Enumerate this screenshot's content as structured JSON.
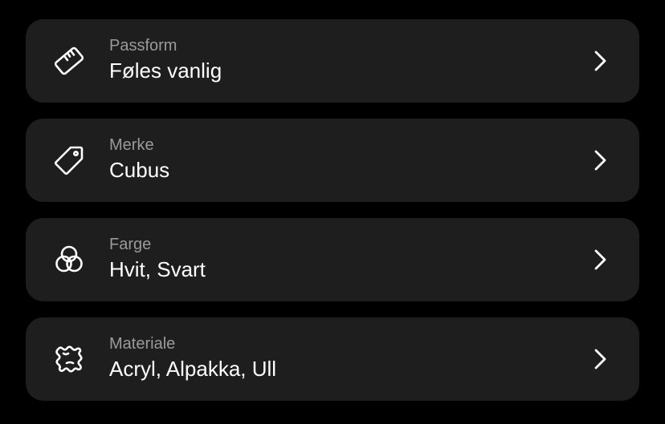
{
  "rows": [
    {
      "icon": "ruler-icon",
      "label": "Passform",
      "value": "Føles vanlig"
    },
    {
      "icon": "tag-icon",
      "label": "Merke",
      "value": "Cubus"
    },
    {
      "icon": "color-circles-icon",
      "label": "Farge",
      "value": "Hvit, Svart"
    },
    {
      "icon": "fabric-swatch-icon",
      "label": "Materiale",
      "value": "Acryl, Alpakka, Ull"
    }
  ],
  "colors": {
    "background": "#000000",
    "row_background": "#1e1e1e",
    "label": "#9a9a9a",
    "value": "#ffffff"
  }
}
